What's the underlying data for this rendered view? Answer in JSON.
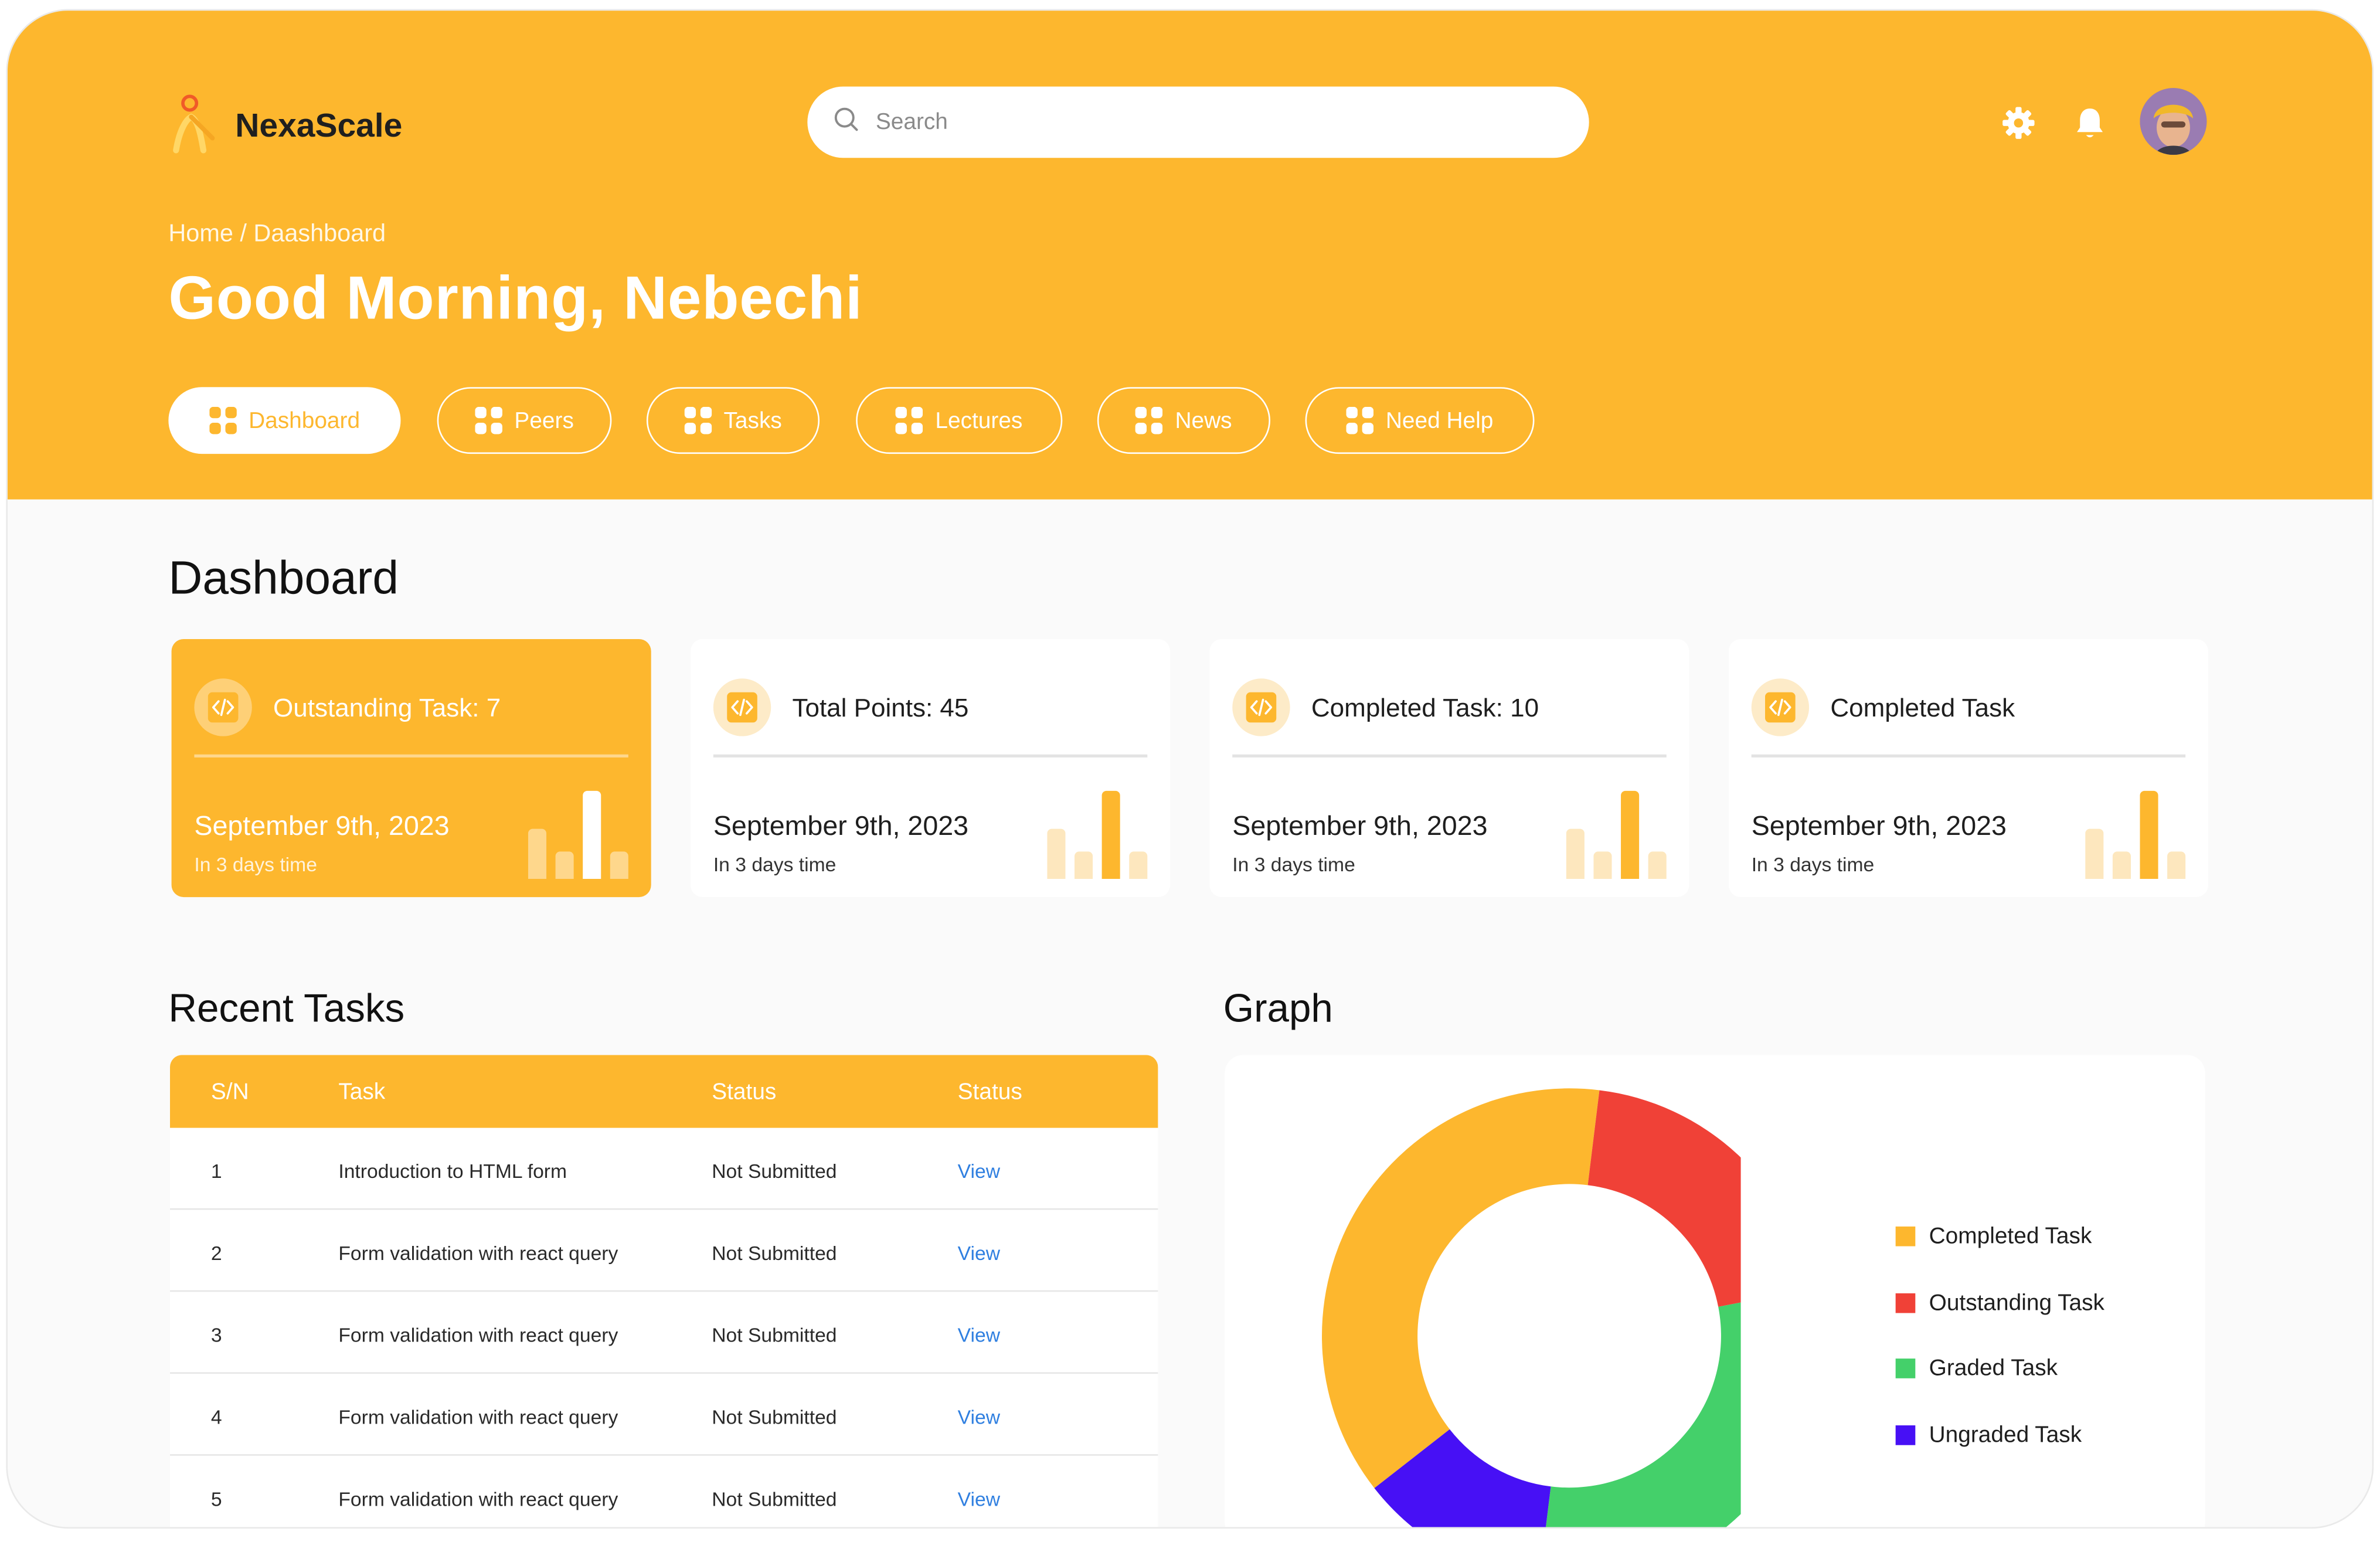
{
  "app": {
    "name": "NexaScale"
  },
  "search": {
    "placeholder": "Search"
  },
  "header": {
    "breadcrumb": "Home / Daashboard",
    "greeting": "Good Morning, Nebechi",
    "settings_icon": "gear-icon",
    "notification_icon": "bell-icon"
  },
  "tabs": [
    {
      "label": "Dashboard",
      "active": true
    },
    {
      "label": "Peers",
      "active": false
    },
    {
      "label": "Tasks",
      "active": false
    },
    {
      "label": "Lectures",
      "active": false
    },
    {
      "label": "News",
      "active": false
    },
    {
      "label": "Need Help",
      "active": false
    }
  ],
  "dashboard": {
    "title": "Dashboard",
    "cards": [
      {
        "title": "Outstanding Task: 7",
        "date": "September 9th, 2023",
        "sub": "In 3 days time",
        "highlight": true
      },
      {
        "title": "Total Points: 45",
        "date": "September 9th, 2023",
        "sub": "In 3 days time",
        "highlight": false
      },
      {
        "title": "Completed Task: 10",
        "date": "September 9th, 2023",
        "sub": "In 3 days time",
        "highlight": false
      },
      {
        "title": "Completed Task",
        "date": "September 9th, 2023",
        "sub": "In 3 days time",
        "highlight": false
      }
    ]
  },
  "recent_tasks": {
    "title": "Recent Tasks",
    "columns": [
      "S/N",
      "Task",
      "Status",
      "Status"
    ],
    "rows": [
      {
        "sn": "1",
        "task": "Introduction to HTML form",
        "status": "Not Submitted",
        "action": "View"
      },
      {
        "sn": "2",
        "task": "Form validation with react query",
        "status": "Not Submitted",
        "action": "View"
      },
      {
        "sn": "3",
        "task": "Form validation with react query",
        "status": "Not Submitted",
        "action": "View"
      },
      {
        "sn": "4",
        "task": "Form validation with react query",
        "status": "Not Submitted",
        "action": "View"
      },
      {
        "sn": "5",
        "task": "Form validation with react query",
        "status": "Not Submitted",
        "action": "View"
      }
    ]
  },
  "graph": {
    "title": "Graph",
    "chart_data": {
      "type": "pie",
      "variant": "donut",
      "categories": [
        "Completed Task",
        "Outstanding Task",
        "Graded Task",
        "Ungraded Task"
      ],
      "values": [
        37.5,
        20,
        30,
        12.5
      ],
      "colors": [
        "#FDB72E",
        "#F04137",
        "#44D06A",
        "#4710F5"
      ],
      "legend_position": "right"
    }
  },
  "colors": {
    "brand": "#FDB72E",
    "link": "#2f7fe0"
  }
}
